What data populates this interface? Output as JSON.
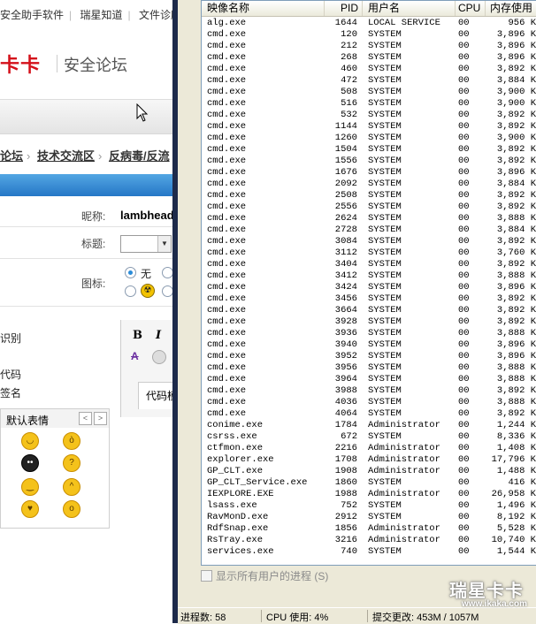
{
  "browser": {
    "nav_links": [
      "安全助手软件",
      "瑞星知道",
      "文件诊所"
    ],
    "logo_red": "卡卡",
    "logo_text": "安全论坛",
    "breadcrumb": [
      "论坛",
      "技术交流区",
      "反病毒/反流"
    ],
    "form": {
      "nickname_label": "昵称:",
      "nickname_value": "lambhead",
      "title_label": "标题:",
      "icon_label": "图标:",
      "icon_none_label": "无"
    },
    "left_labels": [
      "识别",
      "代码",
      "签名"
    ],
    "editor": {
      "bold": "B",
      "italic": "I",
      "code_tab": "代码模"
    },
    "emoticons": {
      "title": "默认表情",
      "prev": "<",
      "next": ">"
    }
  },
  "task_manager": {
    "columns": {
      "name": "映像名称",
      "pid": "PID",
      "user": "用户名",
      "cpu": "CPU",
      "mem": "内存使用"
    },
    "processes": [
      {
        "name": "alg.exe",
        "pid": "1644",
        "user": "LOCAL SERVICE",
        "cpu": "00",
        "mem": "956 K"
      },
      {
        "name": "cmd.exe",
        "pid": "120",
        "user": "SYSTEM",
        "cpu": "00",
        "mem": "3,896 K"
      },
      {
        "name": "cmd.exe",
        "pid": "212",
        "user": "SYSTEM",
        "cpu": "00",
        "mem": "3,896 K"
      },
      {
        "name": "cmd.exe",
        "pid": "268",
        "user": "SYSTEM",
        "cpu": "00",
        "mem": "3,896 K"
      },
      {
        "name": "cmd.exe",
        "pid": "460",
        "user": "SYSTEM",
        "cpu": "00",
        "mem": "3,892 K"
      },
      {
        "name": "cmd.exe",
        "pid": "472",
        "user": "SYSTEM",
        "cpu": "00",
        "mem": "3,884 K"
      },
      {
        "name": "cmd.exe",
        "pid": "508",
        "user": "SYSTEM",
        "cpu": "00",
        "mem": "3,900 K"
      },
      {
        "name": "cmd.exe",
        "pid": "516",
        "user": "SYSTEM",
        "cpu": "00",
        "mem": "3,900 K"
      },
      {
        "name": "cmd.exe",
        "pid": "532",
        "user": "SYSTEM",
        "cpu": "00",
        "mem": "3,892 K"
      },
      {
        "name": "cmd.exe",
        "pid": "1144",
        "user": "SYSTEM",
        "cpu": "00",
        "mem": "3,892 K"
      },
      {
        "name": "cmd.exe",
        "pid": "1260",
        "user": "SYSTEM",
        "cpu": "00",
        "mem": "3,900 K"
      },
      {
        "name": "cmd.exe",
        "pid": "1504",
        "user": "SYSTEM",
        "cpu": "00",
        "mem": "3,892 K"
      },
      {
        "name": "cmd.exe",
        "pid": "1556",
        "user": "SYSTEM",
        "cpu": "00",
        "mem": "3,892 K"
      },
      {
        "name": "cmd.exe",
        "pid": "1676",
        "user": "SYSTEM",
        "cpu": "00",
        "mem": "3,896 K"
      },
      {
        "name": "cmd.exe",
        "pid": "2092",
        "user": "SYSTEM",
        "cpu": "00",
        "mem": "3,884 K"
      },
      {
        "name": "cmd.exe",
        "pid": "2508",
        "user": "SYSTEM",
        "cpu": "00",
        "mem": "3,892 K"
      },
      {
        "name": "cmd.exe",
        "pid": "2556",
        "user": "SYSTEM",
        "cpu": "00",
        "mem": "3,892 K"
      },
      {
        "name": "cmd.exe",
        "pid": "2624",
        "user": "SYSTEM",
        "cpu": "00",
        "mem": "3,888 K"
      },
      {
        "name": "cmd.exe",
        "pid": "2728",
        "user": "SYSTEM",
        "cpu": "00",
        "mem": "3,884 K"
      },
      {
        "name": "cmd.exe",
        "pid": "3084",
        "user": "SYSTEM",
        "cpu": "00",
        "mem": "3,892 K"
      },
      {
        "name": "cmd.exe",
        "pid": "3112",
        "user": "SYSTEM",
        "cpu": "00",
        "mem": "3,760 K"
      },
      {
        "name": "cmd.exe",
        "pid": "3404",
        "user": "SYSTEM",
        "cpu": "00",
        "mem": "3,892 K"
      },
      {
        "name": "cmd.exe",
        "pid": "3412",
        "user": "SYSTEM",
        "cpu": "00",
        "mem": "3,888 K"
      },
      {
        "name": "cmd.exe",
        "pid": "3424",
        "user": "SYSTEM",
        "cpu": "00",
        "mem": "3,896 K"
      },
      {
        "name": "cmd.exe",
        "pid": "3456",
        "user": "SYSTEM",
        "cpu": "00",
        "mem": "3,892 K"
      },
      {
        "name": "cmd.exe",
        "pid": "3664",
        "user": "SYSTEM",
        "cpu": "00",
        "mem": "3,892 K"
      },
      {
        "name": "cmd.exe",
        "pid": "3928",
        "user": "SYSTEM",
        "cpu": "00",
        "mem": "3,892 K"
      },
      {
        "name": "cmd.exe",
        "pid": "3936",
        "user": "SYSTEM",
        "cpu": "00",
        "mem": "3,888 K"
      },
      {
        "name": "cmd.exe",
        "pid": "3940",
        "user": "SYSTEM",
        "cpu": "00",
        "mem": "3,896 K"
      },
      {
        "name": "cmd.exe",
        "pid": "3952",
        "user": "SYSTEM",
        "cpu": "00",
        "mem": "3,896 K"
      },
      {
        "name": "cmd.exe",
        "pid": "3956",
        "user": "SYSTEM",
        "cpu": "00",
        "mem": "3,888 K"
      },
      {
        "name": "cmd.exe",
        "pid": "3964",
        "user": "SYSTEM",
        "cpu": "00",
        "mem": "3,888 K"
      },
      {
        "name": "cmd.exe",
        "pid": "3988",
        "user": "SYSTEM",
        "cpu": "00",
        "mem": "3,892 K"
      },
      {
        "name": "cmd.exe",
        "pid": "4036",
        "user": "SYSTEM",
        "cpu": "00",
        "mem": "3,888 K"
      },
      {
        "name": "cmd.exe",
        "pid": "4064",
        "user": "SYSTEM",
        "cpu": "00",
        "mem": "3,892 K"
      },
      {
        "name": "conime.exe",
        "pid": "1784",
        "user": "Administrator",
        "cpu": "00",
        "mem": "1,244 K"
      },
      {
        "name": "csrss.exe",
        "pid": "672",
        "user": "SYSTEM",
        "cpu": "00",
        "mem": "8,336 K"
      },
      {
        "name": "ctfmon.exe",
        "pid": "2216",
        "user": "Administrator",
        "cpu": "00",
        "mem": "1,408 K"
      },
      {
        "name": "explorer.exe",
        "pid": "1708",
        "user": "Administrator",
        "cpu": "00",
        "mem": "17,796 K"
      },
      {
        "name": "GP_CLT.exe",
        "pid": "1908",
        "user": "Administrator",
        "cpu": "00",
        "mem": "1,488 K"
      },
      {
        "name": "GP_CLT_Service.exe",
        "pid": "1860",
        "user": "SYSTEM",
        "cpu": "00",
        "mem": "416 K"
      },
      {
        "name": "IEXPLORE.EXE",
        "pid": "1988",
        "user": "Administrator",
        "cpu": "00",
        "mem": "26,958 K"
      },
      {
        "name": "lsass.exe",
        "pid": "752",
        "user": "SYSTEM",
        "cpu": "00",
        "mem": "1,496 K"
      },
      {
        "name": "RavMonD.exe",
        "pid": "2912",
        "user": "SYSTEM",
        "cpu": "00",
        "mem": "8,192 K"
      },
      {
        "name": "RdfSnap.exe",
        "pid": "1856",
        "user": "Administrator",
        "cpu": "00",
        "mem": "5,528 K"
      },
      {
        "name": "RsTray.exe",
        "pid": "3216",
        "user": "Administrator",
        "cpu": "00",
        "mem": "10,740 K"
      },
      {
        "name": "services.exe",
        "pid": "740",
        "user": "SYSTEM",
        "cpu": "00",
        "mem": "1,544 K"
      }
    ],
    "show_all_users": "显示所有用户的进程 (S)",
    "status": {
      "processes": "进程数: 58",
      "cpu": "CPU 使用: 4%",
      "commit": "提交更改: 453M / 1057M"
    }
  },
  "watermark": {
    "brand": "瑞星卡卡",
    "url": "www.ikaka.com"
  }
}
